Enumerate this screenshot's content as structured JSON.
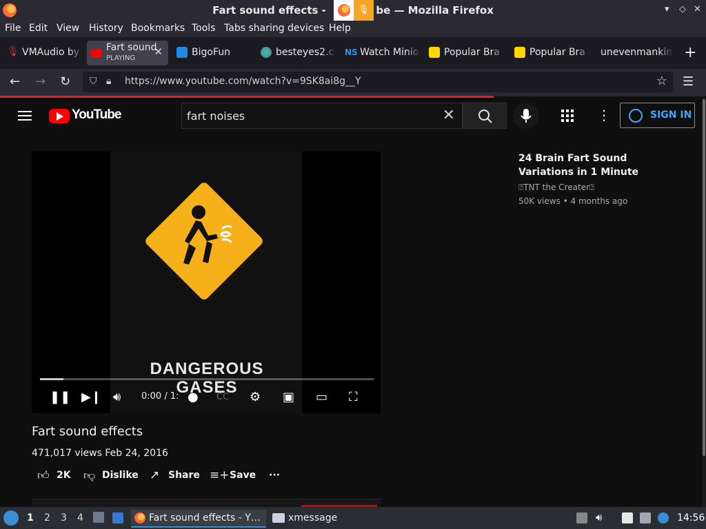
{
  "window": {
    "title": "Fart sound effects - YouTube — Mozilla Firefox",
    "title_visible": "Fart sound effects -",
    "title_visible_end": "be — Mozilla Firefox",
    "minimize": "▾",
    "maximize": "◇",
    "close": "✕"
  },
  "menu": [
    "File",
    "Edit",
    "View",
    "History",
    "Bookmarks",
    "Tools",
    "Tabs sharing devices",
    "Help"
  ],
  "tabs": [
    {
      "label": "VMAudio by",
      "icon": "microphone-icon",
      "color": "#e03030"
    },
    {
      "label": "Fart sound",
      "sub": "PLAYING",
      "icon": "youtube-icon",
      "color": "#ff0000",
      "active": true,
      "close": "✕"
    },
    {
      "label": "BigoFun",
      "icon": "bigofun-icon",
      "color": "#1e88e5"
    },
    {
      "label": "besteyes2.c",
      "icon": "globe-icon",
      "color": "#4caf50"
    },
    {
      "label": "Watch Minio",
      "icon": "ns-icon",
      "color": "#2196f3"
    },
    {
      "label": "Popular Bra",
      "icon": "smiley-icon",
      "color": "#ffd600"
    },
    {
      "label": "Popular Bra",
      "icon": "smiley-icon",
      "color": "#ffd600"
    },
    {
      "label": "unevenmanking",
      "icon": "",
      "color": "#1c1b22"
    }
  ],
  "new_tab": "+",
  "url": "https://www.youtube.com/watch?v=9SK8ai8g__Y",
  "youtube": {
    "logo": "YouTube",
    "search_value": "fart noises",
    "search_clear": "✕",
    "sign_in": "SIGN IN",
    "more": "⋮"
  },
  "player": {
    "sign_text_line1": "DANGEROUS",
    "sign_text_line2": "GASES",
    "time": "0:00 / 1:",
    "progress": 0.07
  },
  "video": {
    "title": "Fart sound effects",
    "meta": "471,017 views  Feb 24, 2016",
    "likes": "2K",
    "dislike": "Dislike",
    "share": "Share",
    "save": "Save",
    "more": "···"
  },
  "recommendation": {
    "title": "24 Brain Fart Sound Variations in 1 Minute",
    "channel": "⍰TNT the Creater⍰",
    "meta": "50K views • 4 months ago"
  },
  "taskbar": {
    "workspaces": [
      "1",
      "2",
      "3",
      "4"
    ],
    "tasks": [
      "Fart sound effects - Y…",
      "xmessage"
    ],
    "clock": "14:56"
  },
  "colors": {
    "accent_blue": "#3ea6ff",
    "youtube_red": "#ff0000",
    "sign_yellow": "#f5b01a"
  }
}
